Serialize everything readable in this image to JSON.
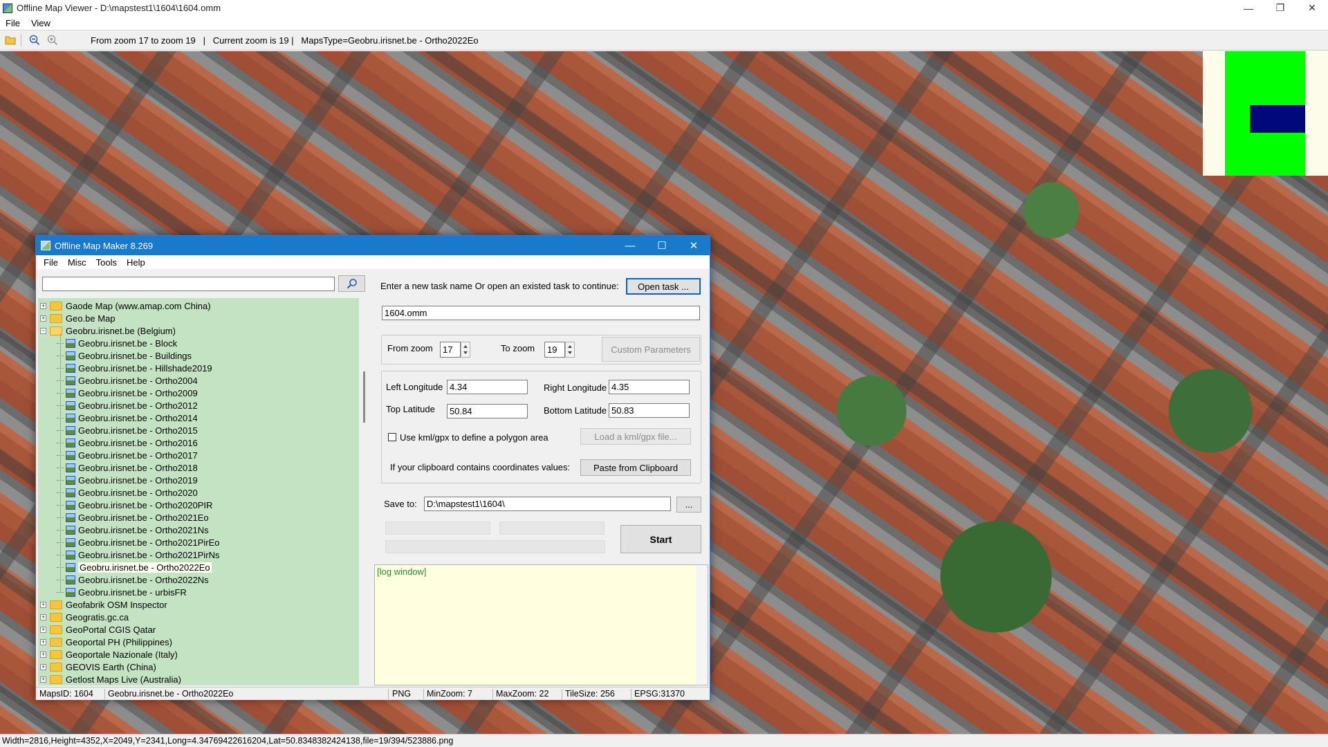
{
  "viewer": {
    "title": "Offline Map Viewer - D:\\mapstest1\\1604\\1604.omm",
    "menu": [
      "File",
      "View"
    ],
    "toolbar_status": "From zoom 17 to zoom 19   |   Current zoom is 19 |   MapsType=Geobru.irisnet.be - Ortho2022Eo",
    "statusbar": "Width=2816,Height=4352,X=2049,Y=2341,Long=4.34769422616204,Lat=50.8348382424138,file=19/394/523886.png"
  },
  "maker": {
    "title": "Offline Map Maker 8.269",
    "menu": [
      "File",
      "Misc",
      "Tools",
      "Help"
    ],
    "search": {
      "value": "",
      "placeholder": ""
    },
    "tree": [
      {
        "label": "Gaode Map (www.amap.com China)",
        "level": 0,
        "expanded": false
      },
      {
        "label": "Geo.be Map",
        "level": 0,
        "expanded": false
      },
      {
        "label": "Geobru.irisnet.be (Belgium)",
        "level": 0,
        "expanded": true
      },
      {
        "label": "Geobru.irisnet.be - Block",
        "level": 1
      },
      {
        "label": "Geobru.irisnet.be - Buildings",
        "level": 1
      },
      {
        "label": "Geobru.irisnet.be - Hillshade2019",
        "level": 1
      },
      {
        "label": "Geobru.irisnet.be - Ortho2004",
        "level": 1
      },
      {
        "label": "Geobru.irisnet.be - Ortho2009",
        "level": 1
      },
      {
        "label": "Geobru.irisnet.be - Ortho2012",
        "level": 1
      },
      {
        "label": "Geobru.irisnet.be - Ortho2014",
        "level": 1
      },
      {
        "label": "Geobru.irisnet.be - Ortho2015",
        "level": 1
      },
      {
        "label": "Geobru.irisnet.be - Ortho2016",
        "level": 1
      },
      {
        "label": "Geobru.irisnet.be - Ortho2017",
        "level": 1
      },
      {
        "label": "Geobru.irisnet.be - Ortho2018",
        "level": 1
      },
      {
        "label": "Geobru.irisnet.be - Ortho2019",
        "level": 1
      },
      {
        "label": "Geobru.irisnet.be - Ortho2020",
        "level": 1
      },
      {
        "label": "Geobru.irisnet.be - Ortho2020PIR",
        "level": 1
      },
      {
        "label": "Geobru.irisnet.be - Ortho2021Eo",
        "level": 1
      },
      {
        "label": "Geobru.irisnet.be - Ortho2021Ns",
        "level": 1
      },
      {
        "label": "Geobru.irisnet.be - Ortho2021PirEo",
        "level": 1
      },
      {
        "label": "Geobru.irisnet.be - Ortho2021PirNs",
        "level": 1
      },
      {
        "label": "Geobru.irisnet.be - Ortho2022Eo",
        "level": 1,
        "selected": true
      },
      {
        "label": "Geobru.irisnet.be - Ortho2022Ns",
        "level": 1
      },
      {
        "label": "Geobru.irisnet.be - urbisFR",
        "level": 1
      },
      {
        "label": "Geofabrik OSM Inspector",
        "level": 0,
        "expanded": false
      },
      {
        "label": "Geogratis.gc.ca",
        "level": 0,
        "expanded": false
      },
      {
        "label": "GeoPortal CGIS Qatar",
        "level": 0,
        "expanded": false
      },
      {
        "label": "Geoportal PH (Philippines)",
        "level": 0,
        "expanded": false
      },
      {
        "label": "Geoportale Nazionale (Italy)",
        "level": 0,
        "expanded": false
      },
      {
        "label": "GEOVIS Earth (China)",
        "level": 0,
        "expanded": false
      },
      {
        "label": "Getlost Maps Live (Australia)",
        "level": 0,
        "expanded": false
      }
    ],
    "form": {
      "task_prompt": "Enter a new task name Or open an existed task to continue:",
      "open_task_label": "Open task ...",
      "task_name": "1604.omm",
      "from_zoom_label": "From zoom",
      "from_zoom": "17",
      "to_zoom_label": "To zoom",
      "to_zoom": "19",
      "custom_params_label": "Custom Parameters",
      "left_lon_label": "Left Longitude",
      "left_lon": "4.34",
      "right_lon_label": "Right Longitude",
      "right_lon": "4.35",
      "top_lat_label": "Top Latitude",
      "top_lat": "50.84",
      "bottom_lat_label": "Bottom Latitude",
      "bottom_lat": "50.83",
      "kml_checkbox_label": "Use kml/gpx to define a polygon area",
      "kml_checked": false,
      "load_kml_label": "Load a kml/gpx file...",
      "clipboard_prompt": "If your clipboard contains coordinates values:",
      "paste_label": "Paste from Clipboard",
      "save_to_label": "Save to:",
      "save_to": "D:\\mapstest1\\1604\\",
      "browse_label": "...",
      "start_label": "Start"
    },
    "log_text": "[log window]",
    "statusbar": {
      "maps_id": "MapsID: 1604",
      "map_name": "Geobru.irisnet.be - Ortho2022Eo",
      "format": "PNG",
      "min_zoom": "MinZoom: 7",
      "max_zoom": "MaxZoom: 22",
      "tile_size": "TileSize: 256",
      "epsg": "EPSG:31370"
    }
  },
  "colors": {
    "maker_titlebar": "#1979ca",
    "tree_bg": "#c3e3c3",
    "log_bg": "#ffffe0",
    "minimap_green": "#00ff00",
    "minimap_viewport": "#00087a"
  }
}
